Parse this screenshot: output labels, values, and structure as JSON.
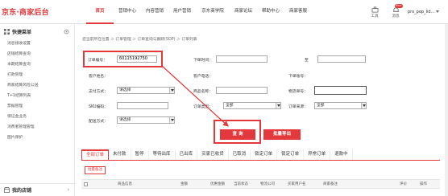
{
  "header": {
    "logo": "京东·商家后台",
    "nav": [
      "首页",
      "营销中心",
      "内容营销",
      "用户营销",
      "京东商学院",
      "商家论坛",
      "帮助中心",
      "商家客服"
    ],
    "tools": [
      {
        "label": "工具",
        "icon": "toolbox-icon"
      },
      {
        "label": "消息",
        "icon": "bell-icon",
        "badge": "99+"
      }
    ],
    "user": "pro_pop_lid..."
  },
  "sidebar": {
    "title": "快捷菜单",
    "items": [
      "消息接收设置",
      "店铺结算查询",
      "本期结算查询",
      "打款管理",
      "商家结算风险公送",
      "T+1结算列表",
      "票据管理",
      "保证金业务",
      "消费者管理管理",
      "图片保护"
    ],
    "footer": "我的店铺",
    "footer_chevron": "›"
  },
  "breadcrumb": "您当前所在位置 ＞ 订单管理 ＞ 订单查询与跟踪(SOP) ＞ 订单列表",
  "form": {
    "order_no_label": "订单编号：",
    "order_no_value": "60115192750",
    "order_time_label": "下单时间：",
    "to_label": "至",
    "customer_name_label": "客户姓名：",
    "customer_phone_label": "客户电话：",
    "account_label": "下单账号：",
    "pay_method_label": "支付方式：",
    "pay_method_value": "请选择",
    "product_name_label": "商品名称：",
    "waybill_label": "物流单号：",
    "sku_label": "SKU编码：",
    "order_type_label": "订单类型：",
    "order_type_value": "全部",
    "order_source_label": "订单来源：",
    "order_source_value": "全部",
    "delivery_label": "配送方式：",
    "delivery_value": "请选择",
    "query_button": "查 询",
    "export_button": "批量导出"
  },
  "tabs": [
    "全部订单",
    "未付款",
    "暂停",
    "等待出库",
    "已出库",
    "买家已收货",
    "已取消",
    "锁定订单",
    "锁定订单",
    "异常订单",
    "退款中"
  ],
  "batch_button": "批量备注",
  "table_headers": [
    "商品信息",
    "金额",
    "优惠金额",
    "当前状态",
    "物流公司",
    "买家用户名",
    "商家备注",
    "评价",
    "操作"
  ],
  "colors": {
    "accent": "#e4393c"
  }
}
